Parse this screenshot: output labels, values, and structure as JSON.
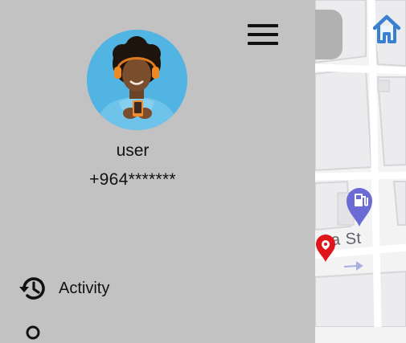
{
  "user": {
    "name": "user",
    "phone": "+964*******"
  },
  "menu": {
    "items": [
      {
        "label": "Activity",
        "icon": "history-icon"
      }
    ]
  },
  "map": {
    "street_label": "a St",
    "markers": [
      "gas-station-marker-icon",
      "location-pin-icon"
    ]
  },
  "colors": {
    "drawer_bg": "#c2c2c2",
    "pin_red": "#e0151b",
    "poi_purple": "#6b6bd6",
    "home_icon_blue": "#3a7fd0"
  }
}
